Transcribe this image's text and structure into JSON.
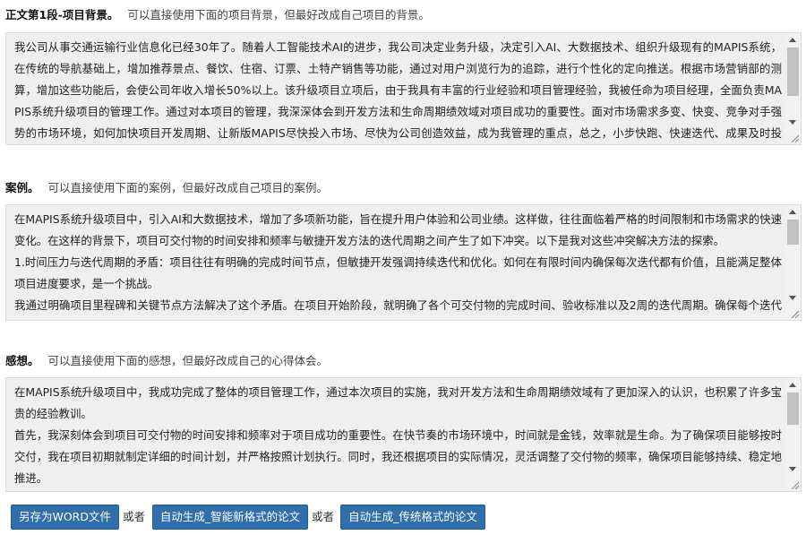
{
  "sections": [
    {
      "title": "正文第1段-项目背景。",
      "hint": "可以直接使用下面的项目背景，但最好改成自己项目的背景。",
      "content": "我公司从事交通运输行业信息化已经30年了。随着人工智能技术AI的进步，我公司决定业务升级，决定引入AI、大数据技术、组织升级现有的MAPIS系统，在传统的导航基础上，增加推荐景点、餐饮、住宿、订票、土特产销售等功能，通过对用户浏览行为的追踪，进行个性化的定向推送。根据市场营销部的测算，增加这些功能后，会使公司年收入增长50%以上。该升级项目立项后，由于我具有丰富的行业经验和项目管理经验，我被任命为项目经理，全面负责MAPIS系统升级项目的管理工作。通过对本项目的管理，我深深体会到开发方法和生命周期绩效域对项目成功的重要性。面对市场需求多变、快变、竞争对手强势的市场环境，如何加快项目开发周期、让新版MAPIS尽快投入市场、尽快为公司创造效益，成为我管理的重点，总之，小步快跑、快速迭代、成果及时投产、......所"
    },
    {
      "title": "案例。",
      "hint": "可以直接使用下面的案例，但最好改成自己项目的案例。",
      "content": "在MAPIS系统升级项目中，引入AI和大数据技术，增加了多项新功能，旨在提升用户体验和公司业绩。这样做，往往面临着严格的时间限制和市场需求的快速变化。在这样的背景下，项目可交付物的时间安排和频率与敏捷开发方法的迭代周期之间产生了如下冲突。以下是我对这些冲突解决方法的探索。\n1.时间压力与迭代周期的矛盾：项目往往有明确的完成时间节点，但敏捷开发强调持续迭代和优化。如何在有限时间内确保每次迭代都有价值，且能满足整体项目进度要求，是一个挑战。\n我通过明确项目里程碑和关键节点方法解决了这个矛盾。在项目开始阶段，就明确了各个可交付物的完成时间、验收标准以及2周的迭代周期。确保每个迭代都"
    },
    {
      "title": "感想。",
      "hint": "可以直接使用下面的感想，但最好改成自己的心得体会。",
      "content": "在MAPIS系统升级项目中，我成功完成了整体的项目管理工作，通过本次项目的实施，我对开发方法和生命周期绩效域有了更加深入的认识，也积累了许多宝贵的经验教训。\n首先，我深刻体会到项目可交付物的时间安排和频率对于项目成功的重要性。在快节奏的市场环境中，时间就是金钱，效率就是生命。为了确保项目能够按时交付，我在项目初期就制定详细的时间计划，并严格按照计划执行。同时，我还根据项目的实际情况，灵活调整了交付物的频率，确保项目能够持续、稳定地推进。"
    }
  ],
  "actions": {
    "save_word_label": "另存为WORD文件",
    "or_label_1": "或者",
    "gen_smart_label": "自动生成_智能新格式的论文",
    "or_label_2": "或者",
    "gen_traditional_label": "自动生成_传统格式的论文"
  },
  "colors": {
    "button_bg": "#2f6fab",
    "textbox_bg": "#efefef"
  }
}
